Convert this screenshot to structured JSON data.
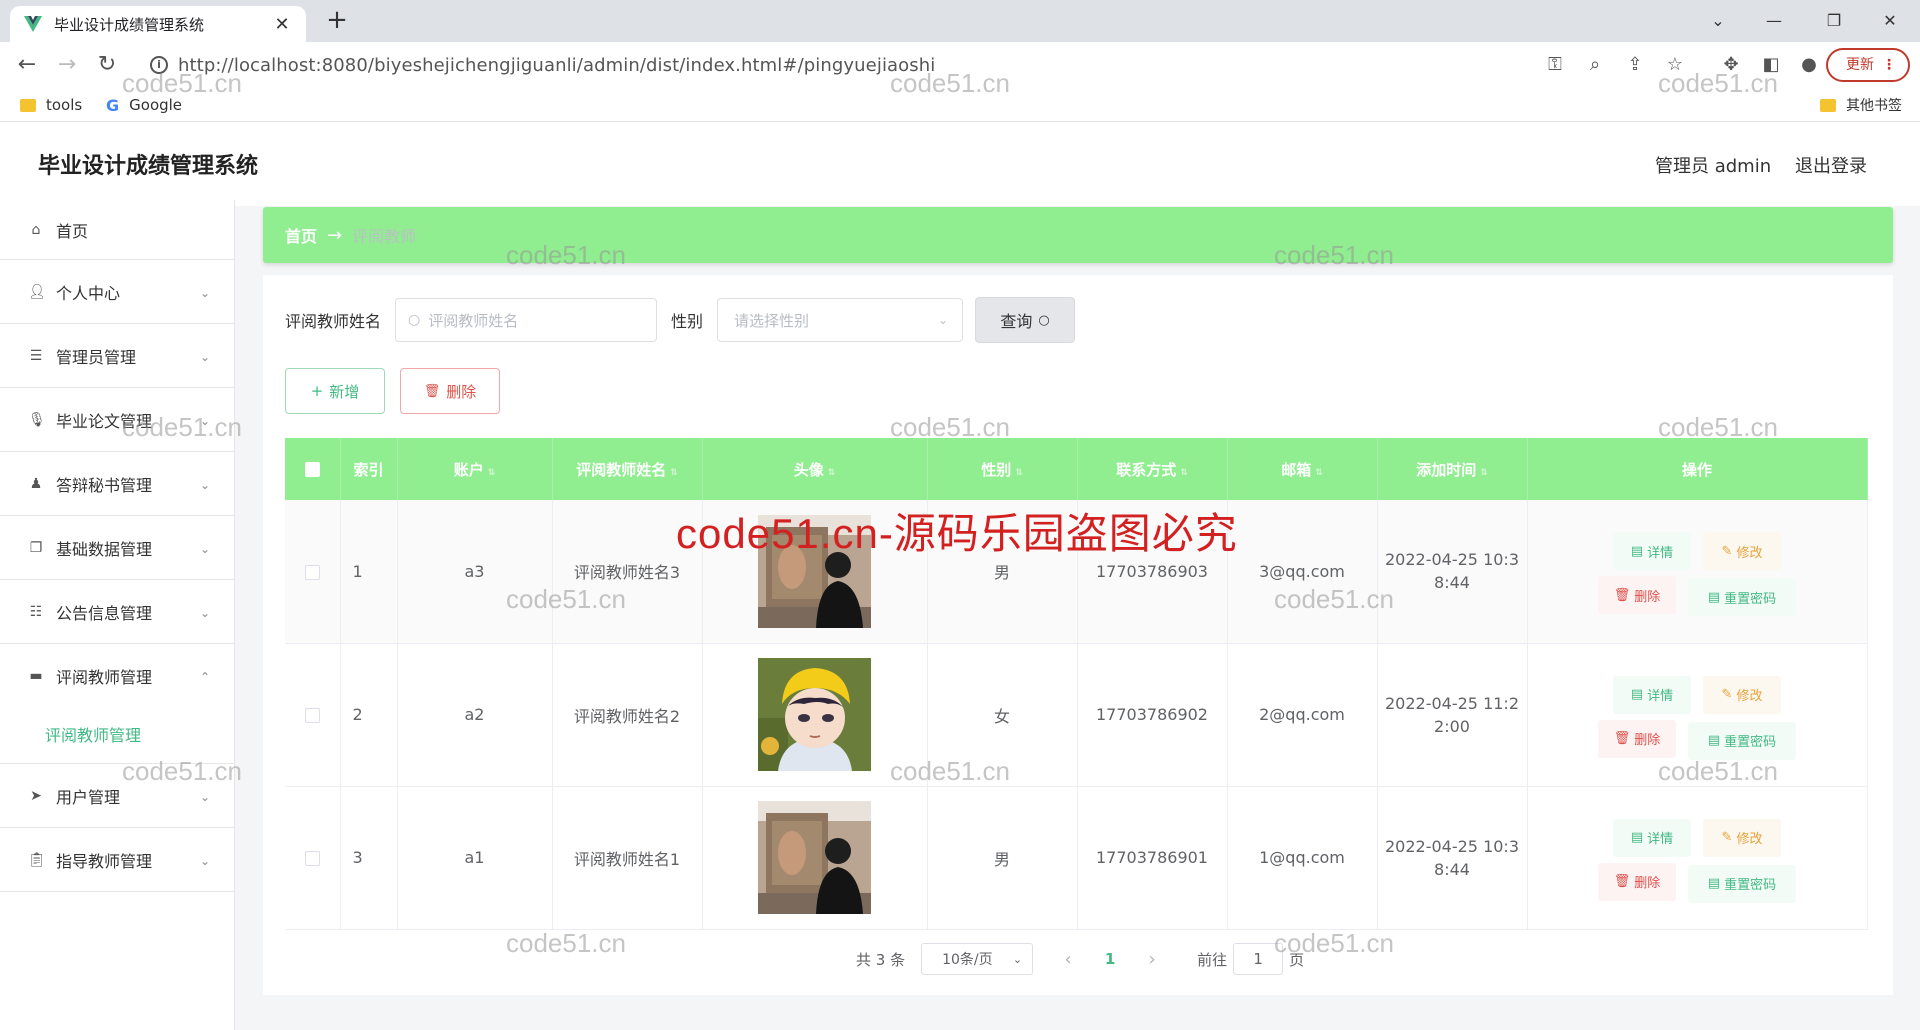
{
  "browser": {
    "tab_title": "毕业设计成绩管理系统",
    "url": "http://localhost:8080/biyeshejichengjiguanli/admin/dist/index.html#/pingyuejiaoshi",
    "update_label": "更新",
    "bookmarks": [
      "tools",
      "Google"
    ],
    "other_bookmarks": "其他书签"
  },
  "header": {
    "title": "毕业设计成绩管理系统",
    "user": "管理员 admin",
    "logout": "退出登录"
  },
  "sidebar": {
    "items": [
      {
        "label": "首页",
        "icon": "home-icon"
      },
      {
        "label": "个人中心",
        "icon": "user-icon"
      },
      {
        "label": "管理员管理",
        "icon": "list-icon"
      },
      {
        "label": "毕业论文管理",
        "icon": "mic-icon"
      },
      {
        "label": "答辩秘书管理",
        "icon": "person-icon"
      },
      {
        "label": "基础数据管理",
        "icon": "copy-icon"
      },
      {
        "label": "公告信息管理",
        "icon": "sliders-icon"
      },
      {
        "label": "评阅教师管理",
        "icon": "monitor-icon"
      },
      {
        "label": "用户管理",
        "icon": "send-icon"
      },
      {
        "label": "指导教师管理",
        "icon": "clipboard-icon"
      }
    ],
    "active_sub": "评阅教师管理"
  },
  "breadcrumb": {
    "home": "首页",
    "arrow": "→",
    "current": "评阅教师"
  },
  "search": {
    "name_label": "评阅教师姓名",
    "name_placeholder": "评阅教师姓名",
    "gender_label": "性别",
    "gender_placeholder": "请选择性别",
    "query_label": "查询"
  },
  "actions": {
    "add_label": "新增",
    "delete_label": "删除"
  },
  "table": {
    "headers": [
      "索引",
      "账户",
      "评阅教师姓名",
      "头像",
      "性别",
      "联系方式",
      "邮箱",
      "添加时间",
      "操作"
    ],
    "rows": [
      {
        "index": "1",
        "account": "a3",
        "name": "评阅教师姓名3",
        "gender": "男",
        "phone": "17703786903",
        "email": "3@qq.com",
        "time_line1": "2022-04-25 10:3",
        "time_line2": "8:44"
      },
      {
        "index": "2",
        "account": "a2",
        "name": "评阅教师姓名2",
        "gender": "女",
        "phone": "17703786902",
        "email": "2@qq.com",
        "time_line1": "2022-04-25 11:2",
        "time_line2": "2:00"
      },
      {
        "index": "3",
        "account": "a1",
        "name": "评阅教师姓名1",
        "gender": "男",
        "phone": "17703786901",
        "email": "1@qq.com",
        "time_line1": "2022-04-25 10:3",
        "time_line2": "8:44"
      }
    ],
    "ops": {
      "detail": "详情",
      "edit": "修改",
      "delete": "删除",
      "reset": "重置密码"
    }
  },
  "pagination": {
    "total": "共 3 条",
    "page_size": "10条/页",
    "current": "1",
    "goto_label": "前往",
    "goto_value": "1",
    "page_unit": "页"
  },
  "watermark": {
    "small": "code51.cn",
    "big": "code51.cn-源码乐园盗图必究"
  },
  "colors": {
    "accent_green": "#90ee90",
    "text_green": "#42b983",
    "edit_orange": "#e6a23c",
    "delete_red": "#e0504a"
  }
}
